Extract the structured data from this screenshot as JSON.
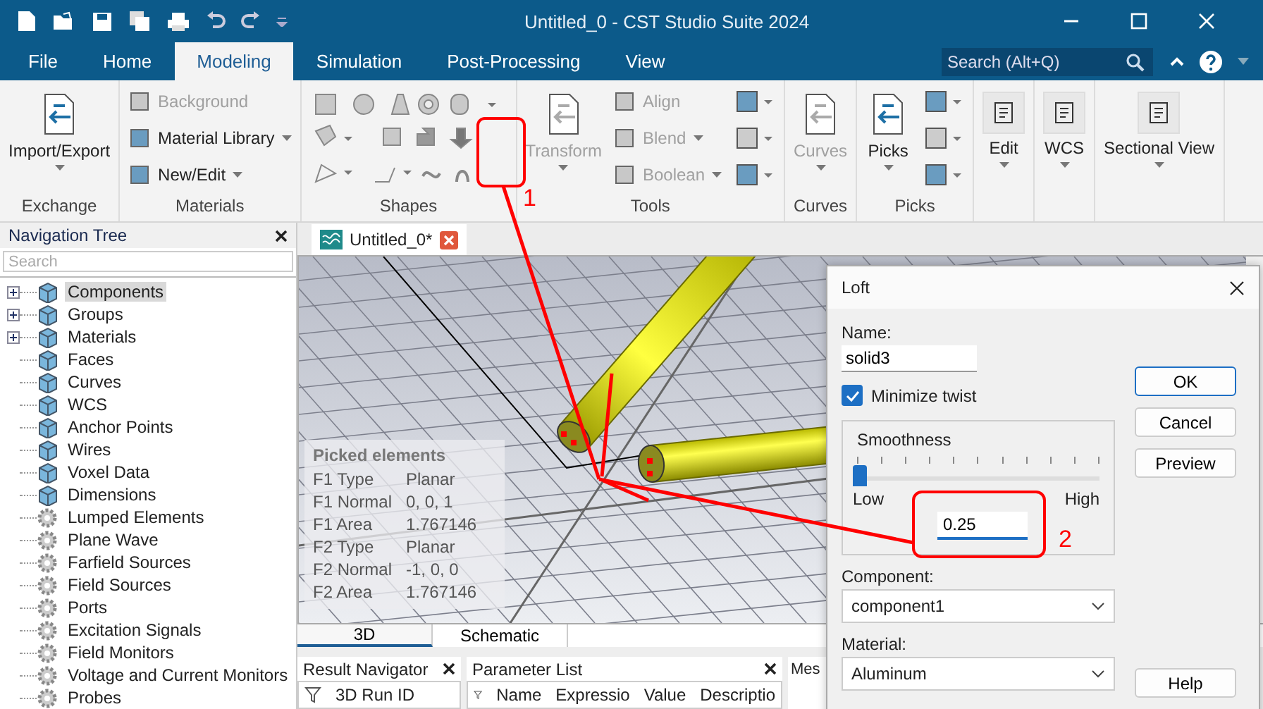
{
  "window": {
    "title": "Untitled_0 - CST Studio Suite 2024"
  },
  "menu_tabs": [
    {
      "label": "File",
      "selected": false
    },
    {
      "label": "Home",
      "selected": false
    },
    {
      "label": "Modeling",
      "selected": true
    },
    {
      "label": "Simulation",
      "selected": false
    },
    {
      "label": "Post-Processing",
      "selected": false
    },
    {
      "label": "View",
      "selected": false
    }
  ],
  "search": {
    "placeholder": "Search (Alt+Q)"
  },
  "ribbon": [
    {
      "label": "Exchange",
      "items": [
        {
          "kind": "large",
          "label": "Import/Export",
          "disabled": false,
          "dropdown": true
        }
      ]
    },
    {
      "label": "Materials",
      "items": [
        {
          "kind": "stack",
          "entries": [
            {
              "label": "Background",
              "disabled": true,
              "dropdown": false
            },
            {
              "label": "Material Library",
              "disabled": false,
              "dropdown": true
            },
            {
              "label": "New/Edit",
              "disabled": false,
              "dropdown": true
            }
          ]
        }
      ]
    },
    {
      "label": "Shapes",
      "items": [
        {
          "kind": "shapes"
        }
      ]
    },
    {
      "label": "Tools",
      "items": [
        {
          "kind": "large",
          "label": "Transform",
          "disabled": true,
          "dropdown": true
        },
        {
          "kind": "stack",
          "entries": [
            {
              "label": "Align",
              "disabled": true,
              "dropdown": false
            },
            {
              "label": "Blend",
              "disabled": true,
              "dropdown": true
            },
            {
              "label": "Boolean",
              "disabled": true,
              "dropdown": true
            }
          ]
        },
        {
          "kind": "icons"
        }
      ]
    },
    {
      "label": "Curves",
      "items": [
        {
          "kind": "large",
          "label": "Curves",
          "disabled": true,
          "dropdown": true
        }
      ]
    },
    {
      "label": "Picks",
      "items": [
        {
          "kind": "large",
          "label": "Picks",
          "disabled": false,
          "dropdown": true
        },
        {
          "kind": "icons"
        }
      ]
    },
    {
      "items": [
        {
          "kind": "boxed",
          "label": "Edit",
          "disabled": false,
          "dropdown": true
        }
      ]
    },
    {
      "items": [
        {
          "kind": "boxed",
          "label": "WCS",
          "disabled": false,
          "dropdown": true
        }
      ]
    },
    {
      "items": [
        {
          "kind": "boxed",
          "label": "Sectional View",
          "disabled": false,
          "dropdown": true
        }
      ]
    }
  ],
  "navigation_tree": {
    "title": "Navigation Tree",
    "search_placeholder": "Search",
    "items": [
      {
        "label": "Components",
        "kind": "component",
        "collapsed": true,
        "selected": true
      },
      {
        "label": "Groups",
        "kind": "component",
        "collapsed": true,
        "selected": false
      },
      {
        "label": "Materials",
        "kind": "component",
        "collapsed": true,
        "selected": false
      },
      {
        "label": "Faces",
        "kind": "component",
        "collapsed": false,
        "selected": false
      },
      {
        "label": "Curves",
        "kind": "component",
        "collapsed": false,
        "selected": false
      },
      {
        "label": "WCS",
        "kind": "component",
        "collapsed": false,
        "selected": false
      },
      {
        "label": "Anchor Points",
        "kind": "component",
        "collapsed": false,
        "selected": false
      },
      {
        "label": "Wires",
        "kind": "component",
        "collapsed": false,
        "selected": false
      },
      {
        "label": "Voxel Data",
        "kind": "component",
        "collapsed": false,
        "selected": false
      },
      {
        "label": "Dimensions",
        "kind": "component",
        "collapsed": false,
        "selected": false
      },
      {
        "label": "Lumped Elements",
        "kind": "setting",
        "collapsed": false,
        "selected": false
      },
      {
        "label": "Plane Wave",
        "kind": "setting",
        "collapsed": false,
        "selected": false
      },
      {
        "label": "Farfield Sources",
        "kind": "setting",
        "collapsed": false,
        "selected": false
      },
      {
        "label": "Field Sources",
        "kind": "setting",
        "collapsed": false,
        "selected": false
      },
      {
        "label": "Ports",
        "kind": "setting",
        "collapsed": false,
        "selected": false
      },
      {
        "label": "Excitation Signals",
        "kind": "setting",
        "collapsed": false,
        "selected": false
      },
      {
        "label": "Field Monitors",
        "kind": "setting",
        "collapsed": false,
        "selected": false
      },
      {
        "label": "Voltage and Current Monitors",
        "kind": "setting",
        "collapsed": false,
        "selected": false
      },
      {
        "label": "Probes",
        "kind": "setting",
        "collapsed": false,
        "selected": false
      }
    ]
  },
  "document_tab": {
    "label": "Untitled_0*"
  },
  "picked_elements": {
    "title": "Picked elements",
    "rows": [
      {
        "label": "F1 Type",
        "value": "Planar"
      },
      {
        "label": "F1 Normal",
        "value": "0, 0, 1"
      },
      {
        "label": "F1 Area",
        "value": "1.767146"
      },
      {
        "label": "F2 Type",
        "value": "Planar"
      },
      {
        "label": "F2 Normal",
        "value": "-1, 0, 0"
      },
      {
        "label": "F2 Area",
        "value": "1.767146"
      }
    ]
  },
  "view_tabs": [
    {
      "label": "3D",
      "selected": true
    },
    {
      "label": "Schematic",
      "selected": false
    }
  ],
  "result_navigator": {
    "title": "Result Navigator",
    "columns": [
      "3D Run ID"
    ]
  },
  "parameter_list": {
    "title": "Parameter List",
    "columns": [
      "Name",
      "Expressio",
      "Value",
      "Descriptio"
    ]
  },
  "messages": {
    "title": "Mes"
  },
  "dialog": {
    "title": "Loft",
    "name_label": "Name:",
    "name_value": "solid3",
    "minimize_twist": {
      "label": "Minimize twist",
      "checked": true
    },
    "smoothness": {
      "title": "Smoothness",
      "level": 0,
      "low": "Low",
      "high": "High",
      "value": "0.25"
    },
    "component_label": "Component:",
    "component_value": "component1",
    "material_label": "Material:",
    "material_value": "Aluminum",
    "buttons": [
      {
        "label": "OK",
        "default": true
      },
      {
        "label": "Cancel",
        "default": false
      },
      {
        "label": "Preview",
        "default": false
      }
    ],
    "help_button": "Help"
  },
  "annotations": [
    {
      "label": "1"
    },
    {
      "label": "2"
    }
  ]
}
